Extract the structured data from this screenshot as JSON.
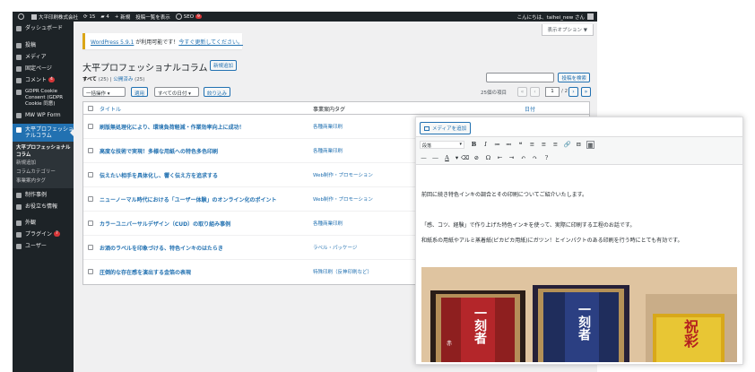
{
  "admin_bar": {
    "site_name": "大平印刷株式会社",
    "updates_count": "15",
    "comments_count": "4",
    "new_label": "新規",
    "view_posts_label": "投稿一覧を表示",
    "seo_label": "SEO",
    "seo_badge": "9",
    "greeting": "こんにちは、taihei_new さん"
  },
  "sidebar": {
    "items": [
      {
        "label": "ダッシュボード"
      },
      {
        "label": "投稿"
      },
      {
        "label": "メディア"
      },
      {
        "label": "固定ページ"
      },
      {
        "label": "コメント",
        "badge": "4"
      },
      {
        "label": "GDPR Cookie Consent (GDPR Cookie 同意)"
      },
      {
        "label": "MW WP Form"
      },
      {
        "label": "大平プロフェッショナルコラム"
      },
      {
        "label": "制作事例"
      },
      {
        "label": "お役立ち情報"
      },
      {
        "label": "外観"
      },
      {
        "label": "プラグイン",
        "badge": "7"
      },
      {
        "label": "ユーザー"
      }
    ],
    "submenu": [
      "大平プロフェッショナルコラム",
      "新規追加",
      "コラムカテゴリー",
      "事業案内タグ"
    ]
  },
  "screen_options": "表示オプション ▼",
  "notice": {
    "text": "WordPress 5.9.1",
    "middle": " が利用可能です！",
    "link": "今すぐ更新してください。"
  },
  "page": {
    "title": "大平プロフェッショナルコラム",
    "add_new": "新規追加",
    "filter_all": "すべて",
    "filter_all_count": "(25)",
    "separator": "|",
    "filter_published": "公開済み",
    "filter_published_count": "(25)",
    "search_button": "投稿を検索",
    "bulk_action": "一括操作 ▾",
    "apply": "適用",
    "all_dates": "すべての日付 ▾",
    "filter_button": "絞り込み",
    "items_count": "25個の項目",
    "page_current": "1",
    "page_total": "/ 2",
    "pg_first": "«",
    "pg_prev": "‹",
    "pg_next": "›",
    "pg_last": "»"
  },
  "table": {
    "headers": {
      "title": "タイトル",
      "category": "事業案内タグ",
      "date": "日付"
    },
    "rows": [
      {
        "title": "刷版無処理化により、環境負荷軽減・作業効率向上に成功！",
        "tag": "各種商業印刷"
      },
      {
        "title": "高度な技術で実現！多様な用紙への特色多色印刷",
        "tag": "各種商業印刷"
      },
      {
        "title": "伝えたい相手を具体化し、響く伝え方を追求する",
        "tag": "Web制作・プロモーション"
      },
      {
        "title": "ニューノーマル時代における「ユーザー体験」のオンライン化のポイント",
        "tag": "Web制作・プロモーション"
      },
      {
        "title": "カラーユニバーサルデザイン（CUD）の取り組み事例",
        "tag": "各種商業印刷"
      },
      {
        "title": "お酒のラベルを印象づける、特色インキのはたらき",
        "tag": "ラベル・パッケージ"
      },
      {
        "title": "圧倒的な存在感を演出する金箔の表現",
        "tag": "特殊印刷（反神印刷など）"
      }
    ]
  },
  "editor": {
    "add_media": "メディアを追加",
    "format_select": "段落",
    "toolbar_row1": [
      "B",
      "I",
      "≔",
      "≕",
      "❝",
      "≡",
      "≡",
      "≡",
      "🔗",
      "⊟",
      "▦"
    ],
    "toolbar_row2": [
      "—",
      "―",
      "A",
      "▾",
      "⌫",
      "⊘",
      "Ω",
      "⇤",
      "⇥",
      "↶",
      "↷",
      "?"
    ],
    "paragraphs": [
      "前回に続き特色インキの調合とその印刷についてご紹介いたします。",
      "「感、コツ、経験」で作り上げた特色インキを使って、実際に印刷する工程のお話です。",
      "和紙系の用紙やアルミ蒸着紙(ピカピカ用紙)にガツン！とインパクトのある印刷を行う時にとても有効です。"
    ],
    "label_1": "一刻者",
    "label_1_sub": "赤",
    "label_2": "一刻者",
    "label_3": "祝彩"
  },
  "colors": {
    "admin_dark": "#1d2327",
    "accent": "#2271b1",
    "badge": "#d63638",
    "notice": "#dba617",
    "background": "#f0f0f1"
  }
}
